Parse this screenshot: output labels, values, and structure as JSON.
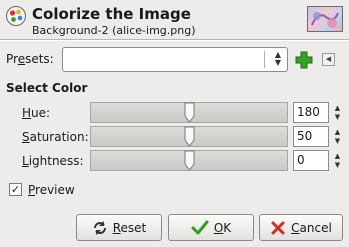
{
  "header": {
    "title": "Colorize the Image",
    "subtitle": "Background-2 (alice-img.png)",
    "icon": "colorize-icon"
  },
  "presets": {
    "label_mnemonic": "e",
    "label_pre": "Pr",
    "label_post": "sets:",
    "value": ""
  },
  "select_color": {
    "title": "Select Color",
    "hue": {
      "mnemonic": "H",
      "rest": "ue:",
      "value": "180",
      "level": 0.5
    },
    "saturation": {
      "mnemonic": "S",
      "rest": "aturation:",
      "value": "50",
      "level": 0.5
    },
    "lightness": {
      "mnemonic": "L",
      "rest": "ightness:",
      "value": "0",
      "level": 0.5
    }
  },
  "preview": {
    "mnemonic": "P",
    "rest": "review",
    "checked": true
  },
  "buttons": {
    "reset": {
      "mnemonic": "R",
      "rest": "eset",
      "icon": "reset-icon"
    },
    "ok": {
      "mnemonic": "O",
      "rest": "K",
      "icon": "check-icon"
    },
    "cancel": {
      "mnemonic": "C",
      "rest": "ancel",
      "icon": "cancel-x-icon"
    }
  },
  "colors": {
    "window_bg": "#edeceb",
    "ok_check": "#2f9e1f",
    "cancel_x": "#d62a1e",
    "add_plus": "#3aa12a"
  }
}
